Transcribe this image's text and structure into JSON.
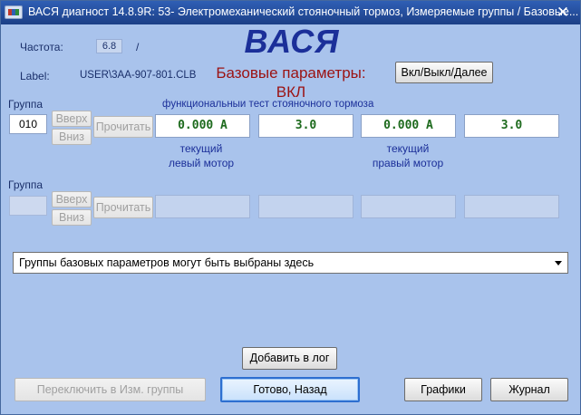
{
  "window": {
    "title": "ВАСЯ диагност 14.8.9R: 53- Электромеханический стояночный тормоз,  Измеряемые группы / Базовые...",
    "close_symbol": "✕"
  },
  "info": {
    "freq_label": "Частота:",
    "freq_value": "6.8",
    "freq_slash": "/",
    "label_key": "Label:",
    "label_value": "USER\\3AA-907-801.CLB"
  },
  "brand": "ВАСЯ",
  "mode": {
    "title": "Базовые параметры:",
    "state": "ВКЛ"
  },
  "toggle_button": "Вкл/Выкл/Далее",
  "group1": {
    "label": "Группа",
    "number": "010",
    "up": "Вверх",
    "down": "Вниз",
    "read": "Прочитать",
    "description": "функциональныи тест стояночного тормоза",
    "values": [
      "0.000 A",
      "3.0",
      "0.000 A",
      "3.0"
    ],
    "sub_left": "текущий",
    "sub_left2": "левый мотор",
    "sub_right": "текущий",
    "sub_right2": "правый мотор"
  },
  "group2": {
    "label": "Группа",
    "number": "",
    "up": "Вверх",
    "down": "Вниз",
    "read": "Прочитать"
  },
  "dropdown": {
    "selected": "Группы базовых параметров могут быть выбраны здесь"
  },
  "buttons": {
    "add_log": "Добавить в лог",
    "switch_groups": "Переключить в Изм. группы",
    "done_back": "Готово, Назад",
    "graphs": "Графики",
    "journal": "Журнал"
  },
  "colors": {
    "background": "#a9c3ec",
    "title_text": "#1b2f99",
    "mode_text": "#9b1212",
    "value_text": "#1d6a1d"
  }
}
